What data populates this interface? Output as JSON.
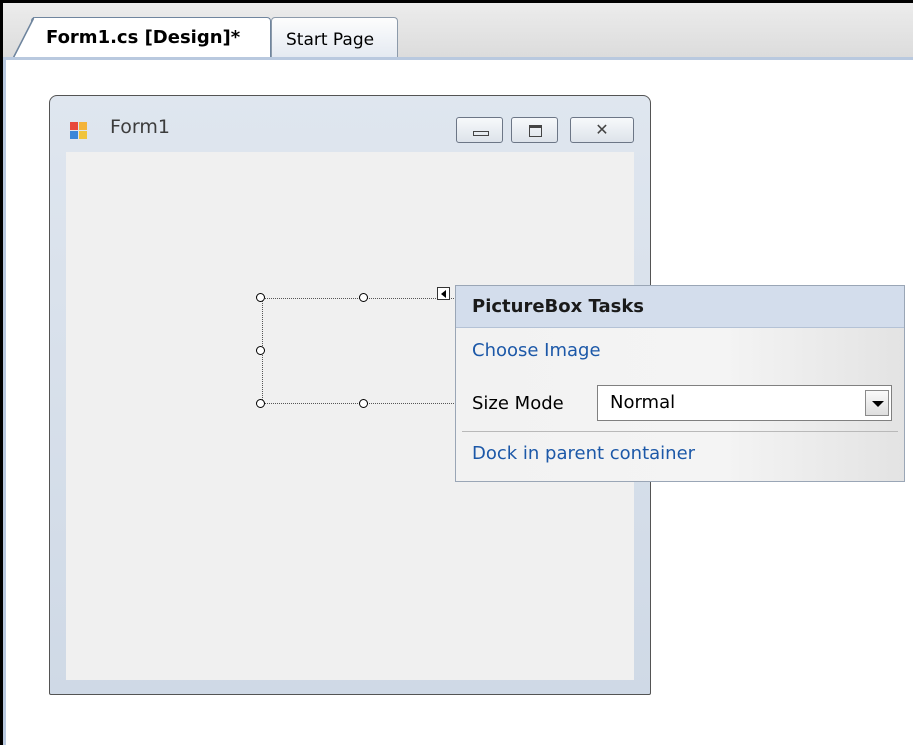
{
  "tabs": [
    {
      "label": "Form1.cs [Design]*",
      "active": true
    },
    {
      "label": "Start Page",
      "active": false
    }
  ],
  "form": {
    "title": "Form1",
    "icon": "form-app-icon"
  },
  "tasks_panel": {
    "title": "PictureBox Tasks",
    "choose_image": "Choose Image",
    "size_mode_label": "Size Mode",
    "size_mode_value": "Normal",
    "dock_link": "Dock in parent container"
  },
  "colors": {
    "link": "#1c58a8",
    "panel_header": "#d3ddec",
    "form_client": "#f0f0f0"
  }
}
